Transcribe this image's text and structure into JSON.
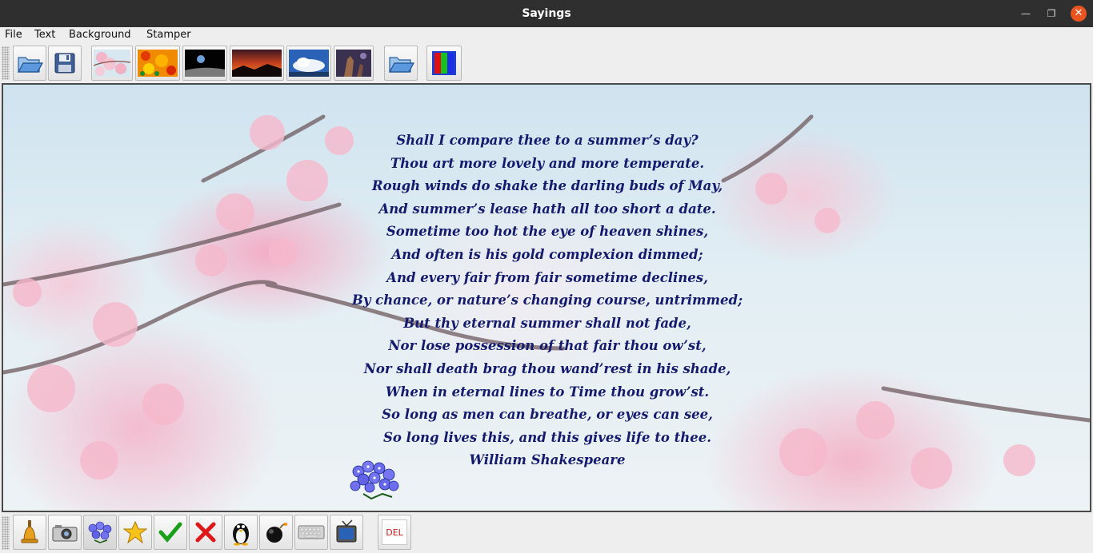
{
  "window": {
    "title": "Sayings"
  },
  "menubar": {
    "items": [
      "File",
      "Text",
      "Background",
      "Stamper"
    ]
  },
  "toolbar_top": {
    "buttons": [
      {
        "icon": "open-folder-icon"
      },
      {
        "icon": "save-disk-icon"
      },
      {
        "icon": "cherry-blossom-thumbnail-icon"
      },
      {
        "icon": "orange-texture-thumbnail-icon"
      },
      {
        "icon": "earthrise-thumbnail-icon"
      },
      {
        "icon": "sunset-thumbnail-icon"
      },
      {
        "icon": "clouds-thumbnail-icon"
      },
      {
        "icon": "nebula-thumbnail-icon"
      },
      {
        "icon": "open-folder-icon"
      },
      {
        "icon": "color-bars-icon"
      }
    ]
  },
  "toolbar_bottom": {
    "buttons": [
      {
        "icon": "bell-icon"
      },
      {
        "icon": "camera-icon"
      },
      {
        "icon": "flower-bouquet-icon"
      },
      {
        "icon": "star-icon"
      },
      {
        "icon": "checkmark-icon"
      },
      {
        "icon": "red-x-icon"
      },
      {
        "icon": "penguin-icon"
      },
      {
        "icon": "bomb-icon"
      },
      {
        "icon": "keyboard-icon"
      },
      {
        "icon": "television-icon"
      }
    ],
    "delete_label": "DEL"
  },
  "poem": {
    "lines": [
      "Shall I compare thee to a summer’s day?",
      "Thou art more lovely and more temperate.",
      "Rough winds do shake the darling buds of May,",
      "And summer’s lease hath all too short a date.",
      "Sometime too hot the eye of heaven shines,",
      "And often is his gold complexion dimmed;",
      "And every fair from fair sometime declines,",
      "By chance, or nature’s changing course, untrimmed;",
      "But thy eternal summer shall not fade,",
      "Nor lose possession of that fair thou ow’st,",
      "Nor shall death brag thou wand’rest in his shade,",
      "When in eternal lines to Time thou grow’st.",
      "So long as men can breathe, or eyes can see,",
      "So long lives this, and this gives life to thee.",
      "William Shakespeare"
    ],
    "color": "#141a6e"
  },
  "colors": {
    "titlebar": "#2f2f2f",
    "close_button": "#e95420",
    "canvas_border": "#4a4a4a"
  }
}
